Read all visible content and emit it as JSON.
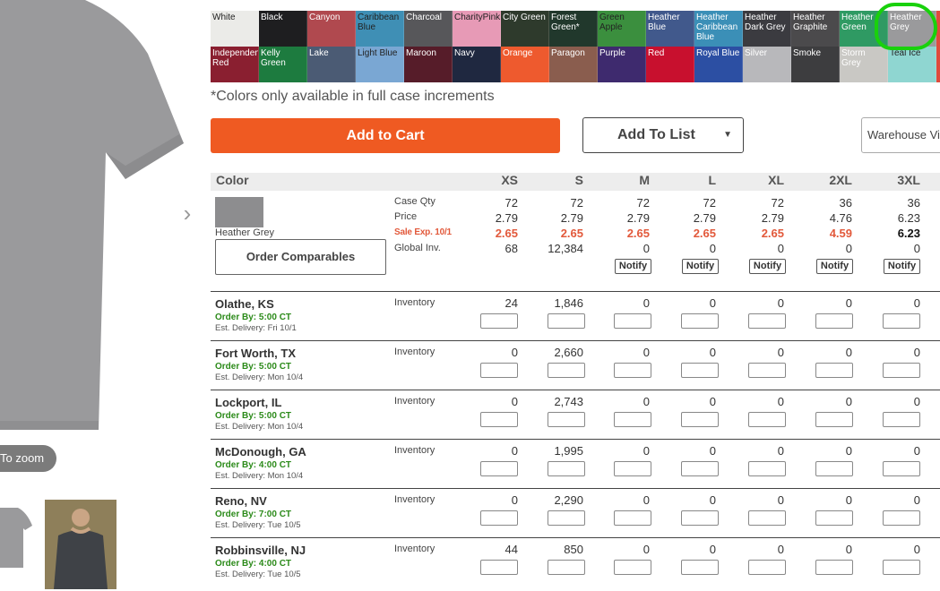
{
  "product": {
    "zoom_label": "To zoom",
    "next_arrow": "›"
  },
  "swatches": [
    {
      "label": "White",
      "color": "#ebebe8",
      "dark_text": true
    },
    {
      "label": "Black",
      "color": "#1e1e20",
      "dark_text": false
    },
    {
      "label": "Canyon",
      "color": "#b0494f",
      "dark_text": false
    },
    {
      "label": "Caribbean Blue",
      "color": "#3f8fb5",
      "dark_text": true
    },
    {
      "label": "Charcoal",
      "color": "#57575a",
      "dark_text": false
    },
    {
      "label": "CharityPink",
      "color": "#e79ab6",
      "dark_text": true
    },
    {
      "label": "City Green",
      "color": "#2e3a2c",
      "dark_text": false
    },
    {
      "label": "Forest Green*",
      "color": "#21382c",
      "dark_text": false
    },
    {
      "label": "Green Apple",
      "color": "#3b8f3e",
      "dark_text": true
    },
    {
      "label": "Heather Blue",
      "color": "#41598c",
      "dark_text": false
    },
    {
      "label": "Heather Caribbean Blue",
      "color": "#3b8fb7",
      "dark_text": false
    },
    {
      "label": "Heather Dark Grey",
      "color": "#3b3b40",
      "dark_text": false
    },
    {
      "label": "Heather Graphite",
      "color": "#4b4a4c",
      "dark_text": false
    },
    {
      "label": "Heather Green",
      "color": "#2f9a63",
      "dark_text": false
    },
    {
      "label": "Heather Grey",
      "color": "#9a9a9c",
      "dark_text": false
    },
    {
      "label": "",
      "color": "#e04a3c",
      "dark_text": false
    },
    {
      "label": "Independence Red",
      "color": "#8a1f30",
      "dark_text": false
    },
    {
      "label": "Kelly Green",
      "color": "#1d7b3f",
      "dark_text": false
    },
    {
      "label": "Lake",
      "color": "#4b5b74",
      "dark_text": false
    },
    {
      "label": "Light Blue",
      "color": "#7aa7d3",
      "dark_text": true
    },
    {
      "label": "Maroon",
      "color": "#561c29",
      "dark_text": false
    },
    {
      "label": "Navy",
      "color": "#1f2840",
      "dark_text": false
    },
    {
      "label": "Orange",
      "color": "#ee5a2e",
      "dark_text": false
    },
    {
      "label": "Paragon",
      "color": "#8a5d4e",
      "dark_text": false
    },
    {
      "label": "Purple",
      "color": "#3e2a6e",
      "dark_text": false
    },
    {
      "label": "Red",
      "color": "#c8102e",
      "dark_text": false
    },
    {
      "label": "Royal Blue",
      "color": "#2c4fa3",
      "dark_text": false
    },
    {
      "label": "Silver",
      "color": "#b8b8bb",
      "dark_text": false
    },
    {
      "label": "Smoke",
      "color": "#3d3d3f",
      "dark_text": false
    },
    {
      "label": "Storm Grey",
      "color": "#c9c8c4",
      "dark_text": false
    },
    {
      "label": "Teal Ice",
      "color": "#8fd6d1",
      "dark_text": true
    },
    {
      "label": "",
      "color": "#e04a3c",
      "dark_text": false
    }
  ],
  "colors_note": "*Colors only available in full case increments",
  "actions": {
    "add_to_cart": "Add to Cart",
    "add_to_list": "Add To List",
    "warehouse_select": "Warehouse Vi"
  },
  "table": {
    "color_header": "Color",
    "sizes": [
      "XS",
      "S",
      "M",
      "L",
      "XL",
      "2XL",
      "3XL"
    ],
    "selected_color_name": "Heather Grey",
    "order_comparables": "Order Comparables",
    "row_labels": {
      "case_qty": "Case Qty",
      "price": "Price",
      "sale": "Sale Exp. 10/1",
      "global_inv": "Global Inv."
    },
    "case_qty": [
      "72",
      "72",
      "72",
      "72",
      "72",
      "36",
      "36"
    ],
    "price": [
      "2.79",
      "2.79",
      "2.79",
      "2.79",
      "2.79",
      "4.76",
      "6.23"
    ],
    "sale_price": [
      "2.65",
      "2.65",
      "2.65",
      "2.65",
      "2.65",
      "4.59",
      "6.23"
    ],
    "global_inv": [
      "68",
      "12,384",
      "0",
      "0",
      "0",
      "0",
      "0"
    ],
    "notify_label": "Notify",
    "inventory_label": "Inventory"
  },
  "warehouses": [
    {
      "name": "Olathe, KS",
      "order_by": "Order By: 5:00 CT",
      "delivery": "Est. Delivery: Fri 10/1",
      "inventory": [
        "24",
        "1,846",
        "0",
        "0",
        "0",
        "0",
        "0"
      ]
    },
    {
      "name": "Fort Worth, TX",
      "order_by": "Order By: 5:00 CT",
      "delivery": "Est. Delivery: Mon 10/4",
      "inventory": [
        "0",
        "2,660",
        "0",
        "0",
        "0",
        "0",
        "0"
      ]
    },
    {
      "name": "Lockport, IL",
      "order_by": "Order By: 5:00 CT",
      "delivery": "Est. Delivery: Mon 10/4",
      "inventory": [
        "0",
        "2,743",
        "0",
        "0",
        "0",
        "0",
        "0"
      ]
    },
    {
      "name": "McDonough, GA",
      "order_by": "Order By: 4:00 CT",
      "delivery": "Est. Delivery: Mon 10/4",
      "inventory": [
        "0",
        "1,995",
        "0",
        "0",
        "0",
        "0",
        "0"
      ]
    },
    {
      "name": "Reno, NV",
      "order_by": "Order By: 7:00 CT",
      "delivery": "Est. Delivery: Tue 10/5",
      "inventory": [
        "0",
        "2,290",
        "0",
        "0",
        "0",
        "0",
        "0"
      ]
    },
    {
      "name": "Robbinsville, NJ",
      "order_by": "Order By: 4:00 CT",
      "delivery": "Est. Delivery: Tue 10/5",
      "inventory": [
        "44",
        "850",
        "0",
        "0",
        "0",
        "0",
        "0"
      ]
    }
  ]
}
